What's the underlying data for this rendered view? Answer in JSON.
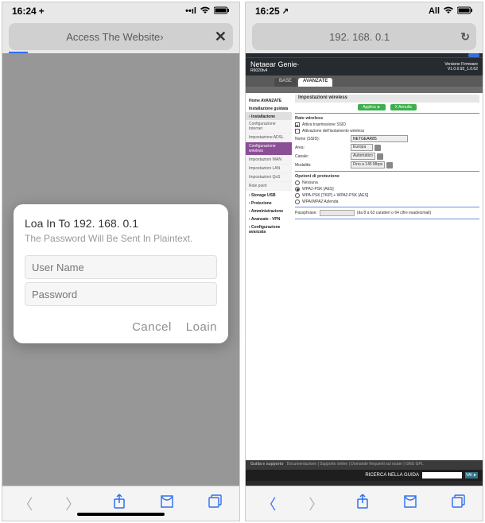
{
  "left": {
    "status": {
      "time": "16:24",
      "plus": "+",
      "signal": "••ıl",
      "wifi": "📶",
      "battery": "■"
    },
    "url": "Access The Website›",
    "dialog": {
      "title": "Loa In To 192. 168. 0.1",
      "subtitle": "The Password Will Be Sent In Plaintext.",
      "user_ph": "User Name",
      "pass_ph": "Password",
      "cancel": "Cancel",
      "login": "Loain"
    }
  },
  "right": {
    "status": {
      "time": "16:25",
      "arrow": "↗",
      "all": "All",
      "wifi": "📶",
      "battery": "■"
    },
    "url": "192. 168. 0.1",
    "router": {
      "brand": "Netaear Genie·",
      "model": "R6020tv4",
      "version_l1": "Versione Firmware",
      "version_l2": "V1.0.0.92_1.0.62",
      "tabs": {
        "base": "BASE",
        "advanced": "AVANZATE"
      },
      "sidebar": {
        "group1": "Home AVANZATE",
        "group2": "Installazione guidata",
        "sec_inst": "› Installazione",
        "items": {
          "conf_int": "Configurazione Internet",
          "imp_adsl": "Impostazione ADSL",
          "conf_wifi": "Configurazione wireless",
          "imp_wan": "Impostazioni WAN",
          "imp_lan": "Impostazioni LAN",
          "imp_qos": "Impostazioni QoS",
          "role": "Role point"
        },
        "sec_usb": "› Storage USB",
        "sec_prot": "› Protezione",
        "sec_admin": "› Amministrazione",
        "sec_vpn": "› Avanzate - VPN",
        "sec_conf": "› Configurazione avanzata"
      },
      "panel": {
        "heading": "Impostazioni wireless",
        "apply": "Applica ►",
        "cancel": "X Annulla",
        "rate_title": "Rate wireless",
        "chk_ssid": "Attiva trasmissione SSID",
        "chk_iso": "Attivazione dell'isolamento wireless",
        "name_lbl": "Nome (SSID):",
        "name_val": "NETGEAR85",
        "area_lbl": "Area:",
        "area_val": "Europa",
        "chan_lbl": "Canale:",
        "chan_val": "Automatico",
        "mode_lbl": "Modalità:",
        "mode_val": "Fino a 145 Mbps",
        "sec_title": "Opzioni di protezione",
        "opt_none": "Nessuna",
        "opt_aes": "WPA2-PSK [AES]",
        "opt_mix": "WPA-PSK [TKIP] + WPA2-PSK [AES]",
        "opt_ent": "WPA/WPA2 Azlenda",
        "pp_lbl": "Passphrase:",
        "pp_hint": "(da 8 a 63 caratteri o 64 cifre esadecimali)"
      },
      "footer": {
        "guide": "Guida e supporto",
        "links": "Documentazione  |  Supporto online  |  Domande frequenti sul router  |  GNU GPL",
        "search_lbl": "RICERCA NELLA GUIDA",
        "go": "VAI ►"
      }
    }
  }
}
